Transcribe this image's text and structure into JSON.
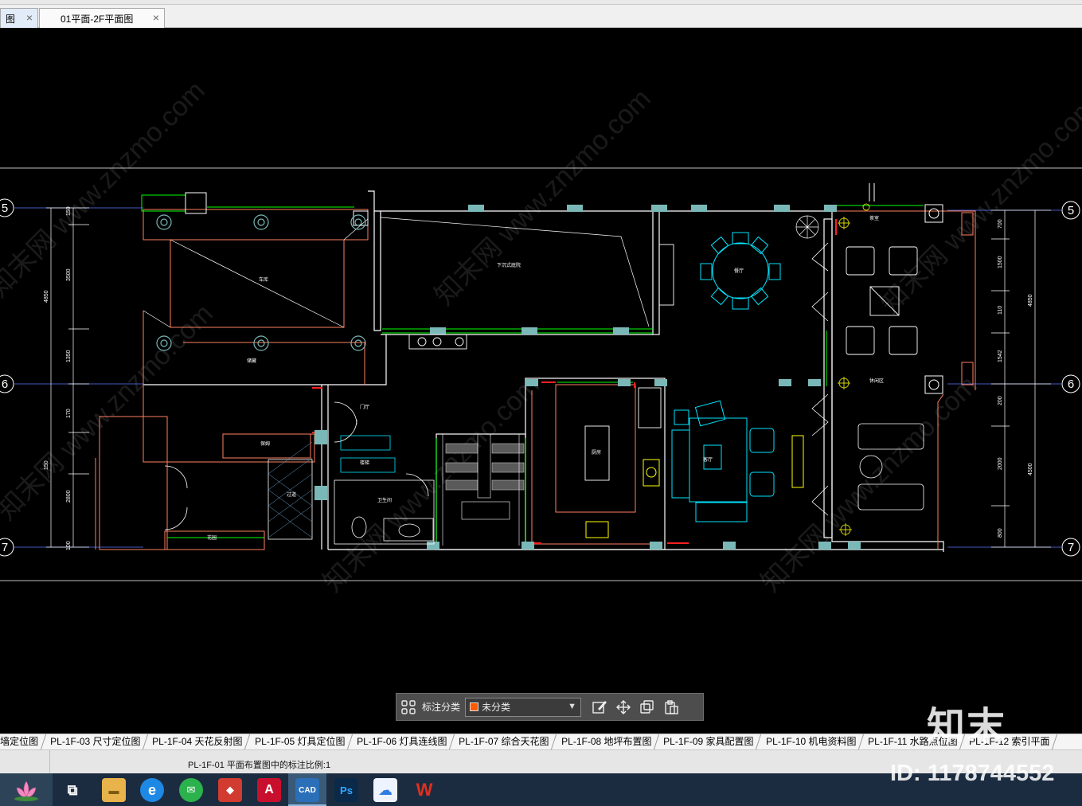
{
  "document_tabs": [
    {
      "label": "图",
      "close": "×",
      "active": true
    },
    {
      "label": "01平面-2F平面图",
      "close": "×",
      "active": false
    }
  ],
  "drawing": {
    "axis_labels": [
      "5",
      "6",
      "7"
    ],
    "left_dimensions": [
      "4850",
      "150",
      "3500",
      "1350",
      "170",
      "150",
      "2800",
      "100"
    ],
    "right_dimensions": [
      "4850",
      "4500",
      "700",
      "1500",
      "110",
      "1542",
      "200",
      "2000",
      "800"
    ],
    "room_labels": [
      "车库",
      "下沉式庭院",
      "储藏",
      "门厅",
      "楼梯",
      "卫生间",
      "保姆",
      "客厅",
      "餐厅",
      "厨房",
      "茶室",
      "休闲区",
      "过道",
      "花园"
    ],
    "watermark": "知末网 www.znzmo.com",
    "colors": {
      "wall": "#ffffff",
      "outline": "#ff7f5f",
      "glass": "#00ff00",
      "furniture": "#00e5ff",
      "fixture": "#ffff00",
      "column": "#7ab8b8",
      "red": "#ff2020"
    }
  },
  "annotation_bar": {
    "label": "标注分类",
    "selected": "未分类",
    "selected_color": "#ff5a00",
    "icons": [
      "grid-icon",
      "edit-icon",
      "move-icon",
      "copy-icon",
      "paste-icon"
    ]
  },
  "layout_tabs": [
    "墙定位图",
    "PL-1F-03 尺寸定位图",
    "PL-1F-04 天花反射图",
    "PL-1F-05 灯具定位图",
    "PL-1F-06 灯具连线图",
    "PL-1F-07 综合天花图",
    "PL-1F-08 地坪布置图",
    "PL-1F-09 家具配置图",
    "PL-1F-10 机电资料图",
    "PL-1F-11 水路点位图",
    "PL-1F-12 索引平面"
  ],
  "status": {
    "text": "PL-1F-01 平面布置图中的标注比例:1"
  },
  "overlay_watermark": {
    "brand": "知末",
    "id": "ID: 1178744552"
  },
  "taskbar": {
    "apps": [
      {
        "name": "task-view-icon",
        "glyph": "⧉",
        "color": "#1b2c40"
      },
      {
        "name": "file-explorer-icon",
        "glyph": "▬",
        "color": "#e8b34a"
      },
      {
        "name": "ie-browser-icon",
        "glyph": "e",
        "color": "#1e88e5"
      },
      {
        "name": "wechat-icon",
        "glyph": "✉",
        "color": "#2bb24c"
      },
      {
        "name": "sketchup-icon",
        "glyph": "◆",
        "color": "#d23b2f"
      },
      {
        "name": "autocad-icon",
        "glyph": "A",
        "color": "#c8102e"
      },
      {
        "name": "cad-viewer-icon",
        "glyph": "CAD",
        "color": "#2a6fb8"
      },
      {
        "name": "photoshop-icon",
        "glyph": "Ps",
        "color": "#0b2a4a"
      },
      {
        "name": "baidu-netdisk-icon",
        "glyph": "☁",
        "color": "#2f7de1"
      },
      {
        "name": "wps-icon",
        "glyph": "W",
        "color": "#e0301e"
      }
    ]
  }
}
